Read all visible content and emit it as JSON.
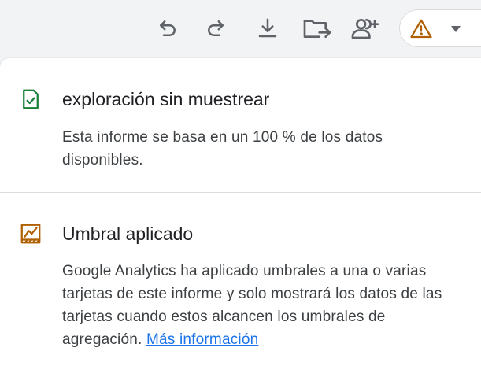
{
  "colors": {
    "icon_gray": "#5f6368",
    "success_green": "#188038",
    "warning_orange": "#b06000",
    "link_blue": "#1a73e8",
    "title_text": "#202124",
    "body_text": "#3c4043"
  },
  "toolbar": {
    "icons": [
      "undo-icon",
      "redo-icon",
      "download-icon",
      "move-to-folder-icon",
      "share-user-add-icon",
      "warning-icon",
      "caret-down-icon"
    ]
  },
  "unsampled": {
    "title": "exploración sin muestrear",
    "body": "Esta informe se basa en un 100 % de los datos disponibles."
  },
  "threshold": {
    "title": "Umbral aplicado",
    "body": "Google Analytics ha aplicado umbrales a una o varias tarjetas de este informe y solo mostrará los datos de las tarjetas cuando estos alcancen los umbrales de agregación.",
    "link_text": "Más información"
  }
}
